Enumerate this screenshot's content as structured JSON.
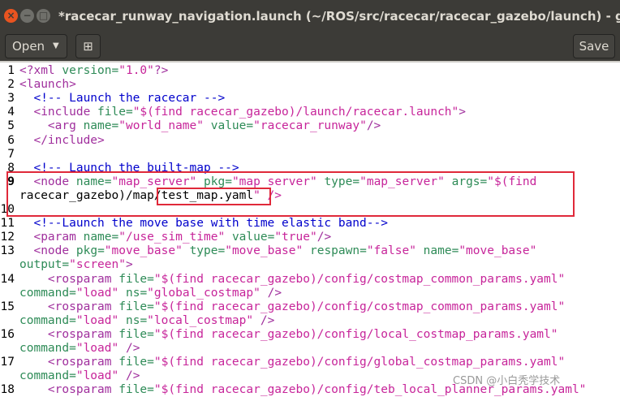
{
  "window": {
    "title": "*racecar_runway_navigation.launch (~/ROS/src/racecar/racecar_gazebo/launch) - gedit",
    "close_glyph": "×",
    "min_glyph": "−",
    "max_glyph": "□"
  },
  "toolbar": {
    "open_label": "Open",
    "open_caret": "▼",
    "new_doc_glyph": "⊞",
    "save_label": "Save"
  },
  "editor": {
    "current_line": 9,
    "rows": [
      {
        "num": "1",
        "text": "<?xml version=\"1.0\"?>"
      },
      {
        "num": "2",
        "text": "<launch>"
      },
      {
        "num": "3",
        "text": "  <!-- Launch the racecar -->"
      },
      {
        "num": "4",
        "text": "  <include file=\"$(find racecar_gazebo)/launch/racecar.launch\">"
      },
      {
        "num": "5",
        "text": "    <arg name=\"world_name\" value=\"racecar_runway\"/>"
      },
      {
        "num": "6",
        "text": "  </include>"
      },
      {
        "num": "7",
        "text": ""
      },
      {
        "num": "8",
        "text": "  <!-- Launch the built-map -->"
      },
      {
        "num": "9",
        "text": "  <node name=\"map_server\" pkg=\"map_server\" type=\"map_server\" args=\"$(find"
      },
      {
        "num": "",
        "text": "racecar_gazebo)/map/test_map.yaml\" />"
      },
      {
        "num": "10",
        "text": ""
      },
      {
        "num": "11",
        "text": "  <!--Launch the move base with time elastic band-->"
      },
      {
        "num": "12",
        "text": "  <param name=\"/use_sim_time\" value=\"true\"/>"
      },
      {
        "num": "13",
        "text": "  <node pkg=\"move_base\" type=\"move_base\" respawn=\"false\" name=\"move_base\""
      },
      {
        "num": "",
        "text": "output=\"screen\">"
      },
      {
        "num": "14",
        "text": "    <rosparam file=\"$(find racecar_gazebo)/config/costmap_common_params.yaml\""
      },
      {
        "num": "",
        "text": "command=\"load\" ns=\"global_costmap\" />"
      },
      {
        "num": "15",
        "text": "    <rosparam file=\"$(find racecar_gazebo)/config/costmap_common_params.yaml\""
      },
      {
        "num": "",
        "text": "command=\"load\" ns=\"local_costmap\" />"
      },
      {
        "num": "16",
        "text": "    <rosparam file=\"$(find racecar_gazebo)/config/local_costmap_params.yaml\""
      },
      {
        "num": "",
        "text": "command=\"load\" />"
      },
      {
        "num": "17",
        "text": "    <rosparam file=\"$(find racecar_gazebo)/config/global_costmap_params.yaml\""
      },
      {
        "num": "",
        "text": "command=\"load\" />"
      },
      {
        "num": "18",
        "text": "    <rosparam file=\"$(find racecar_gazebo)/config/teb_local_planner_params.yaml\""
      }
    ]
  },
  "colors": {
    "tag": "#a02f9d",
    "attribute": "#2e8b57",
    "string": "#c7259a",
    "comment": "#0000cc",
    "highlight_box": "#e0293a"
  },
  "watermark": "CSDN @小白秃学技术"
}
